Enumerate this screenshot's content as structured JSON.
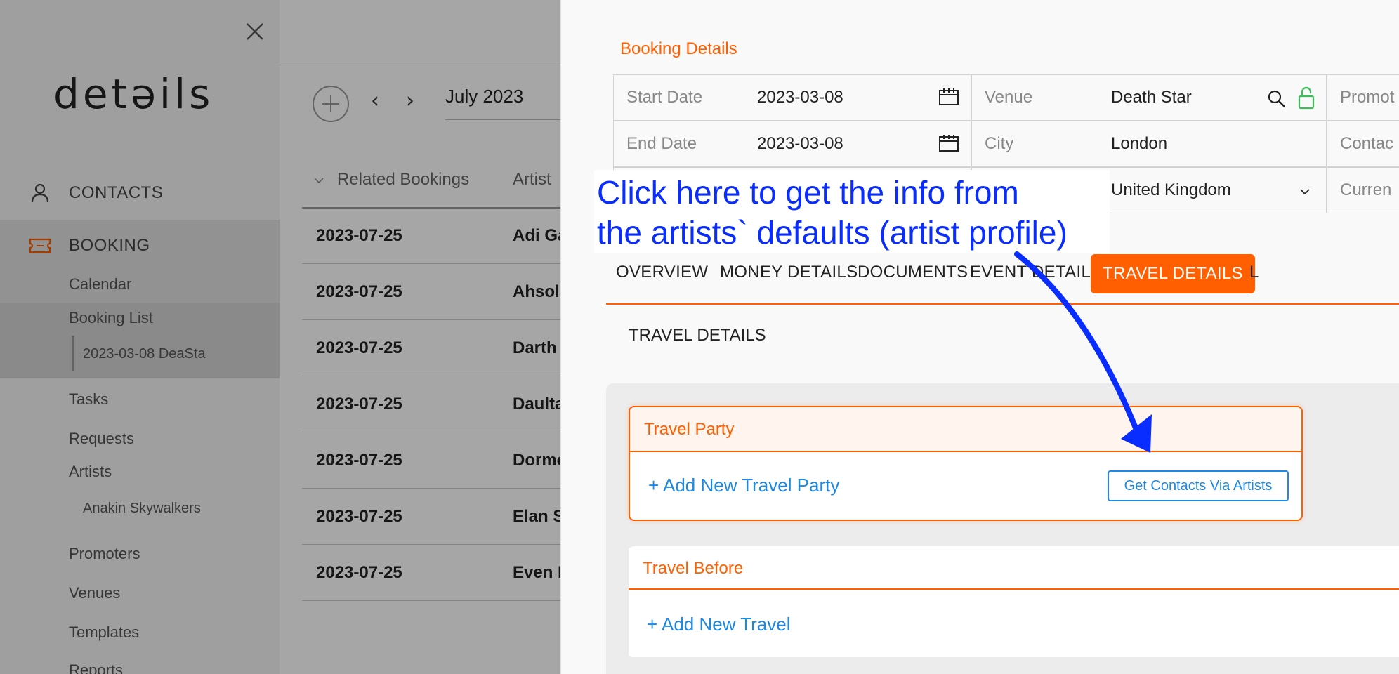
{
  "sidebar": {
    "logo": "detəils",
    "contacts_label": "CONTACTS",
    "booking_label": "BOOKING",
    "items": {
      "calendar": "Calendar",
      "booking_list": "Booking List",
      "booking_entry": "2023-03-08 DeaSta",
      "tasks": "Tasks",
      "requests": "Requests",
      "artists": "Artists",
      "artist_entry": "Anakin Skywalkers",
      "promoters": "Promoters",
      "venues": "Venues",
      "templates": "Templates",
      "reports": "Reports"
    }
  },
  "main": {
    "month": "July 2023",
    "columns": {
      "related": "Related Bookings",
      "artist": "Artist"
    },
    "rows": [
      {
        "date": "2023-07-25",
        "artist": "Adi Ga"
      },
      {
        "date": "2023-07-25",
        "artist": "Ahsol"
      },
      {
        "date": "2023-07-25",
        "artist": "Darth"
      },
      {
        "date": "2023-07-25",
        "artist": "Daulta"
      },
      {
        "date": "2023-07-25",
        "artist": "Dorme"
      },
      {
        "date": "2023-07-25",
        "artist": "Elan S"
      },
      {
        "date": "2023-07-25",
        "artist": "Even I"
      }
    ]
  },
  "drawer": {
    "title": "Booking Details",
    "fields": {
      "start_date": {
        "label": "Start Date",
        "value": "2023-03-08"
      },
      "end_date": {
        "label": "End Date",
        "value": "2023-03-08"
      },
      "venue": {
        "label": "Venue",
        "value": "Death Star"
      },
      "city": {
        "label": "City",
        "value": "London"
      },
      "country": {
        "value": "United Kingdom"
      },
      "promoter": {
        "label": "Promot"
      },
      "contact": {
        "label": "Contac"
      },
      "currency": {
        "label": "Curren"
      }
    },
    "tabs": [
      "OVERVIEW",
      "MONEY DETAILS",
      "DOCUMENTS",
      "EVENT DETAILS",
      "TRAVEL DETAILS",
      "L"
    ],
    "active_tab": "TRAVEL DETAILS",
    "section_label": "TRAVEL DETAILS",
    "travel_party": {
      "title": "Travel Party",
      "add_label": "+ Add New Travel Party",
      "button_label": "Get Contacts Via Artists"
    },
    "travel_before": {
      "title": "Travel Before",
      "add_label": "+ Add New Travel"
    }
  },
  "annotation": {
    "line1": "Click here to get the info from",
    "line2": "the artists` defaults (artist profile)",
    "color": "#0a2dff"
  },
  "colors": {
    "accent": "#ff5f00",
    "link": "#1e88e5",
    "unlock": "#3cbf5a"
  },
  "icons": [
    "close-icon",
    "person-icon",
    "ticket-icon",
    "add-circle-icon",
    "chevron-left-icon",
    "chevron-right-icon",
    "calendar-icon",
    "search-icon",
    "unlock-icon",
    "chevron-down-icon",
    "sort-chevron-icon"
  ]
}
